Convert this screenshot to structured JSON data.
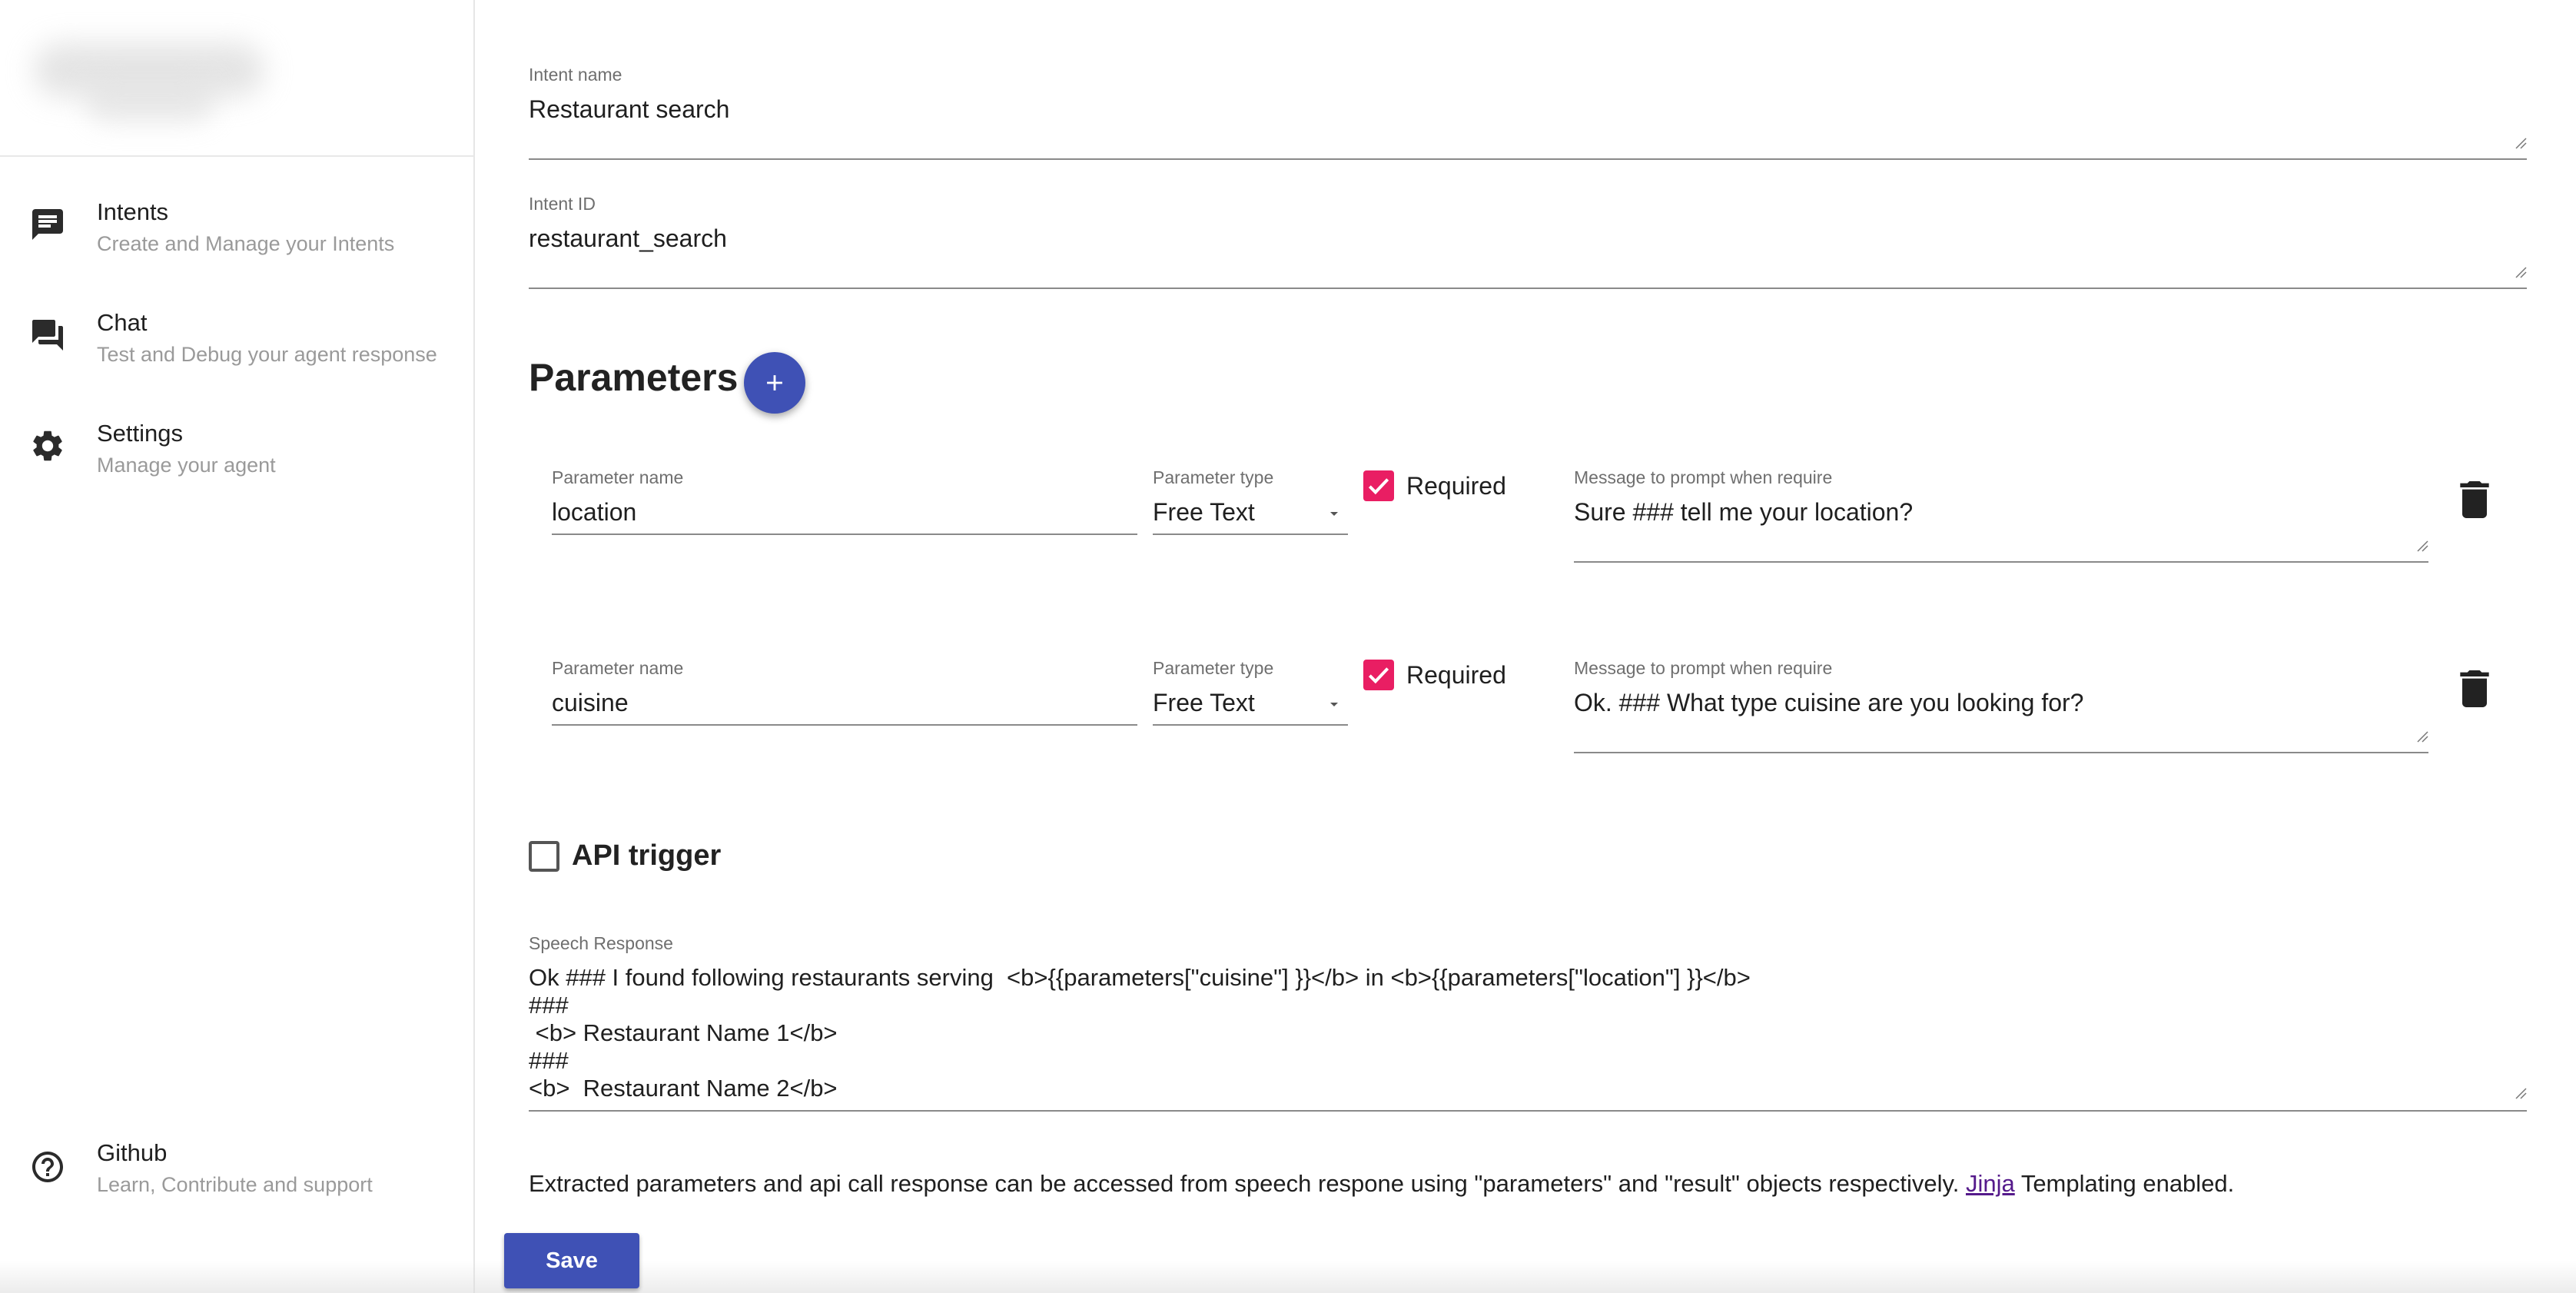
{
  "sidebar": {
    "items": [
      {
        "title": "Intents",
        "subtitle": "Create and Manage your Intents",
        "icon": "intents-icon"
      },
      {
        "title": "Chat",
        "subtitle": "Test and Debug your agent response",
        "icon": "chat-icon"
      },
      {
        "title": "Settings",
        "subtitle": "Manage your agent",
        "icon": "settings-icon"
      }
    ],
    "footer": {
      "title": "Github",
      "subtitle": "Learn, Contribute and support",
      "icon": "help-icon"
    }
  },
  "form": {
    "intent_name_label": "Intent name",
    "intent_name_value": "Restaurant search",
    "intent_id_label": "Intent ID",
    "intent_id_value": "restaurant_search",
    "parameters_title": "Parameters",
    "parameters": [
      {
        "name_label": "Parameter name",
        "name_value": "location",
        "type_label": "Parameter type",
        "type_value": "Free Text",
        "required_label": "Required",
        "required": true,
        "prompt_label": "Message to prompt when require",
        "prompt_value": "Sure ### tell me your location?"
      },
      {
        "name_label": "Parameter name",
        "name_value": "cuisine",
        "type_label": "Parameter type",
        "type_value": "Free Text",
        "required_label": "Required",
        "required": true,
        "prompt_label": "Message to prompt when require",
        "prompt_value": "Ok. ### What type cuisine are you looking for?"
      }
    ],
    "api_trigger_label": "API trigger",
    "api_trigger_checked": false,
    "speech_label": "Speech Response",
    "speech_value": "Ok ### I found following restaurants serving  <b>{{parameters[\"cuisine\"] }}</b> in <b>{{parameters[\"location\"] }}</b>\n###\n <b> Restaurant Name 1</b>\n###\n<b>  Restaurant Name 2</b>",
    "hint_text": "Extracted parameters and api call response can be accessed from speech respone using \"parameters\" and \"result\" objects respectively.",
    "hint_link": "Jinja",
    "hint_suffix": "Templating enabled.",
    "save_label": "Save"
  },
  "colors": {
    "primary": "#3f51b5",
    "checkbox": "#e91e63",
    "link": "#551a8b"
  }
}
